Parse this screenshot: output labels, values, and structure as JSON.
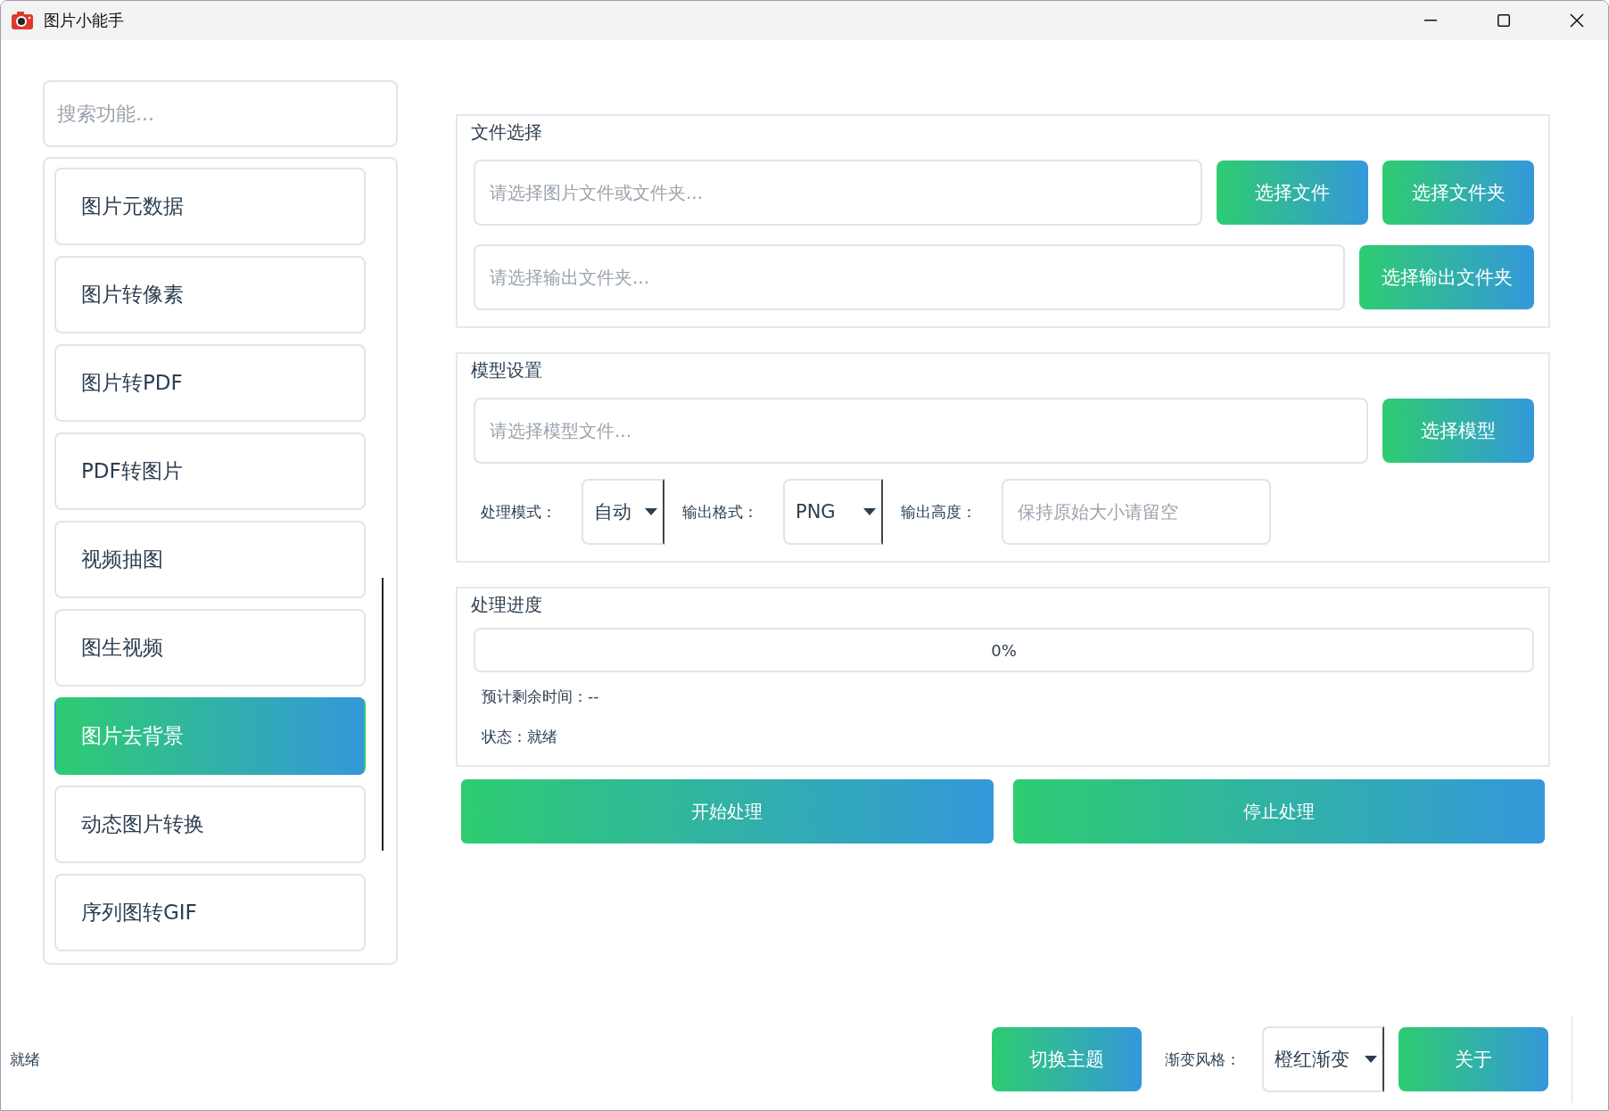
{
  "window": {
    "title": "图片小能手"
  },
  "sidebar": {
    "search": {
      "placeholder": "搜索功能..."
    },
    "items": [
      {
        "label": "图片元数据",
        "selected": false
      },
      {
        "label": "图片转像素",
        "selected": false
      },
      {
        "label": "图片转PDF",
        "selected": false
      },
      {
        "label": "PDF转图片",
        "selected": false
      },
      {
        "label": "视频抽图",
        "selected": false
      },
      {
        "label": "图生视频",
        "selected": false
      },
      {
        "label": "图片去背景",
        "selected": true
      },
      {
        "label": "动态图片转换",
        "selected": false
      },
      {
        "label": "序列图转GIF",
        "selected": false
      }
    ]
  },
  "file_selection": {
    "title": "文件选择",
    "input_file": {
      "placeholder": "请选择图片文件或文件夹..."
    },
    "buttons": [
      "选择文件",
      "选择文件夹"
    ],
    "output_folder": {
      "placeholder": "请选择输出文件夹..."
    },
    "output_button": "选择输出文件夹"
  },
  "model_settings": {
    "title": "模型设置",
    "model_file": {
      "placeholder": "请选择模型文件..."
    },
    "button": "选择模型",
    "options": [
      {
        "kind": "dropdown",
        "label": "处理模式：",
        "value": "自动"
      },
      {
        "kind": "dropdown",
        "label": "输出格式：",
        "value": "PNG"
      },
      {
        "kind": "input",
        "label": "输出高度：",
        "placeholder": "保持原始大小请留空"
      }
    ]
  },
  "progress": {
    "title": "处理进度",
    "level": 0,
    "reading": "0%",
    "eta": "预计剩余时间：--",
    "status": "状态：就绪"
  },
  "actions": [
    "开始处理",
    "停止处理"
  ],
  "status_bar": {
    "text": "就绪",
    "theme_button": "切换主题",
    "style_label": "渐变风格：",
    "style_value": "橙红渐变",
    "about_button": "关于"
  }
}
